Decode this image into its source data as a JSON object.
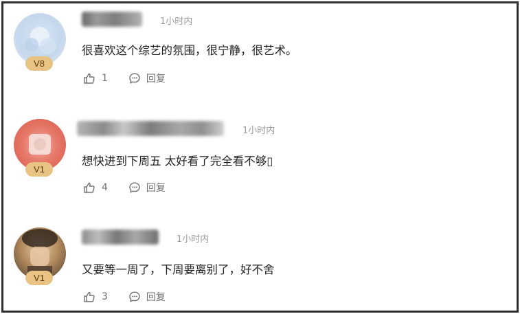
{
  "comments": [
    {
      "badge": "V8",
      "time": "1小时内",
      "text": "很喜欢这个综艺的氛围，很宁静，很艺术。",
      "likes": "1",
      "reply_label": "回复"
    },
    {
      "badge": "V1",
      "time": "1小时内",
      "text": "想快进到下周五 太好看了完全看不够▯",
      "likes": "4",
      "reply_label": "回复"
    },
    {
      "badge": "V1",
      "time": "1小时内",
      "text": "又要等一周了，下周要离别了，好不舍",
      "likes": "3",
      "reply_label": "回复"
    }
  ],
  "colors": {
    "badge": "#e9c383",
    "timestamp": "#9c9c9c",
    "frame_border": "#2d2d2d"
  },
  "icons": [
    "thumbs-up-icon",
    "reply-bubble-icon"
  ]
}
